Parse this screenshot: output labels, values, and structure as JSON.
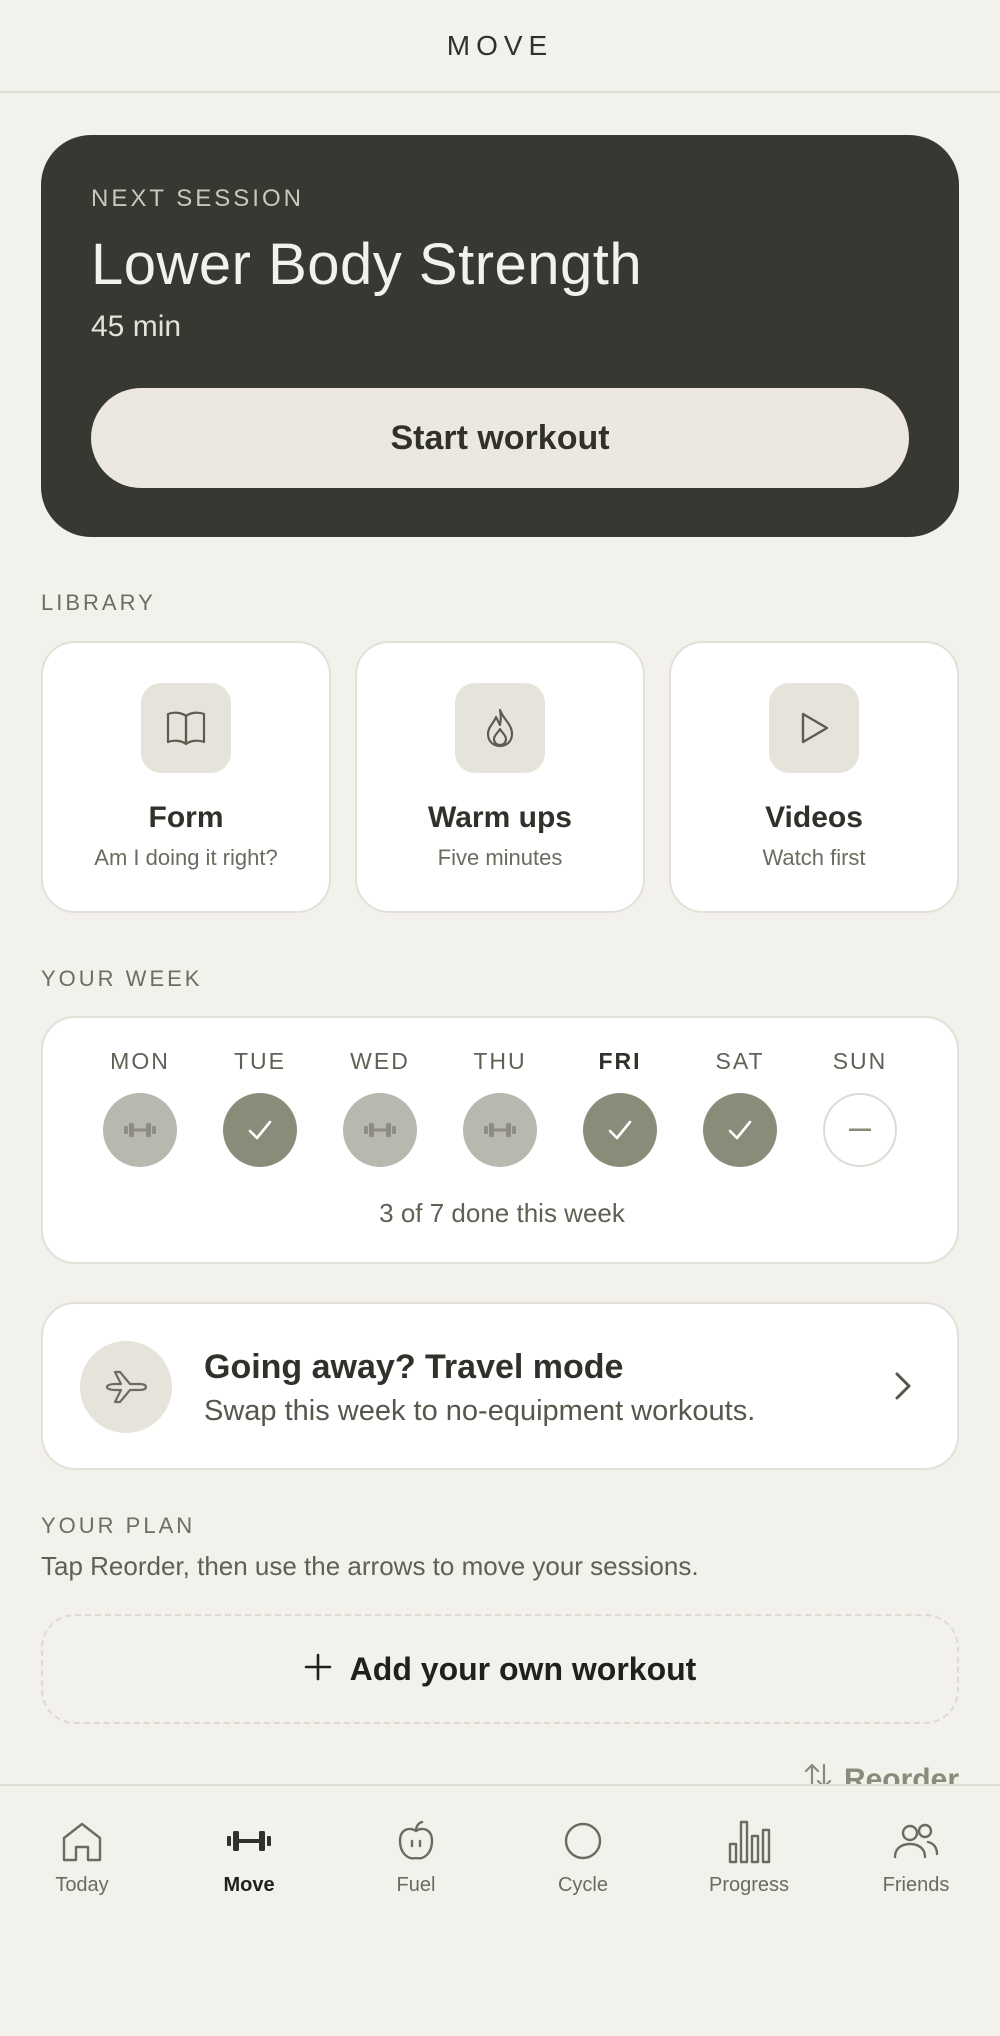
{
  "header": {
    "title": "MOVE"
  },
  "next_session": {
    "eyebrow": "NEXT SESSION",
    "name": "Lower Body Strength",
    "duration": "45 min",
    "start_label": "Start workout"
  },
  "library": {
    "label": "LIBRARY",
    "items": [
      {
        "title": "Form",
        "subtitle": "Am I doing it right?",
        "icon": "book-icon"
      },
      {
        "title": "Warm ups",
        "subtitle": "Five minutes",
        "icon": "flame-icon"
      },
      {
        "title": "Videos",
        "subtitle": "Watch first",
        "icon": "play-icon"
      }
    ]
  },
  "week": {
    "label": "YOUR WEEK",
    "days": [
      {
        "name": "MON",
        "status": "planned"
      },
      {
        "name": "TUE",
        "status": "done"
      },
      {
        "name": "WED",
        "status": "planned"
      },
      {
        "name": "THU",
        "status": "planned"
      },
      {
        "name": "FRI",
        "status": "done",
        "today": true
      },
      {
        "name": "SAT",
        "status": "done"
      },
      {
        "name": "SUN",
        "status": "rest"
      }
    ],
    "summary": "3 of 7 done this week"
  },
  "travel": {
    "title": "Going away? Travel mode",
    "subtitle": "Swap this week to no-equipment workouts.",
    "icon": "plane-icon"
  },
  "plan": {
    "label": "YOUR PLAN",
    "hint": "Tap Reorder, then use the arrows to move your sessions.",
    "add_label": "Add your own workout",
    "reorder_label": "Reorder"
  },
  "nav": {
    "items": [
      {
        "label": "Today",
        "icon": "home-icon"
      },
      {
        "label": "Move",
        "icon": "dumbbell-icon",
        "active": true
      },
      {
        "label": "Fuel",
        "icon": "apple-icon"
      },
      {
        "label": "Cycle",
        "icon": "circle-icon"
      },
      {
        "label": "Progress",
        "icon": "bar-chart-icon"
      },
      {
        "label": "Friends",
        "icon": "friends-icon"
      }
    ]
  },
  "colors": {
    "background": "#f2f1ec",
    "hero": "#363831",
    "done": "#8a8c7a",
    "planned": "#b9b8ae"
  }
}
